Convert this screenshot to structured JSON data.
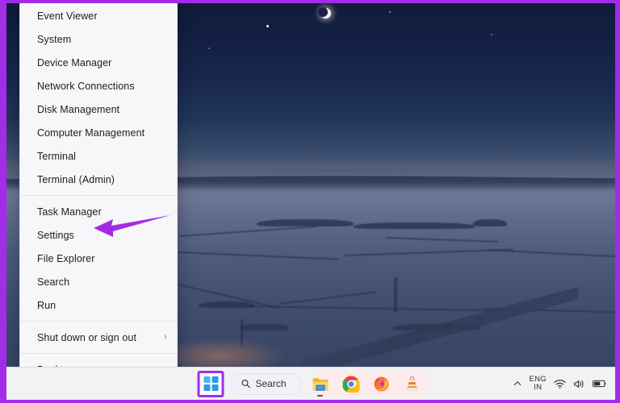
{
  "window": {
    "os": "Windows 11",
    "annotation_color": "#a32ce8"
  },
  "context_menu": {
    "name": "Win+X Quick Link menu",
    "items": [
      {
        "label": "Event Viewer",
        "has_submenu": false,
        "separator_after": false
      },
      {
        "label": "System",
        "has_submenu": false,
        "separator_after": false
      },
      {
        "label": "Device Manager",
        "has_submenu": false,
        "separator_after": false
      },
      {
        "label": "Network Connections",
        "has_submenu": false,
        "separator_after": false
      },
      {
        "label": "Disk Management",
        "has_submenu": false,
        "separator_after": false
      },
      {
        "label": "Computer Management",
        "has_submenu": false,
        "separator_after": false
      },
      {
        "label": "Terminal",
        "has_submenu": false,
        "separator_after": false
      },
      {
        "label": "Terminal (Admin)",
        "has_submenu": false,
        "separator_after": true
      },
      {
        "label": "Task Manager",
        "has_submenu": false,
        "separator_after": false
      },
      {
        "label": "Settings",
        "has_submenu": false,
        "separator_after": false,
        "highlighted_by_arrow": true
      },
      {
        "label": "File Explorer",
        "has_submenu": false,
        "separator_after": false
      },
      {
        "label": "Search",
        "has_submenu": false,
        "separator_after": false
      },
      {
        "label": "Run",
        "has_submenu": false,
        "separator_after": true
      },
      {
        "label": "Shut down or sign out",
        "has_submenu": true,
        "submenu_glyph": "›",
        "separator_after": true
      },
      {
        "label": "Desktop",
        "has_submenu": false,
        "separator_after": false
      }
    ]
  },
  "annotation": {
    "arrow_target": "Settings",
    "arrow_direction": "left",
    "color": "#a22ce6"
  },
  "taskbar": {
    "start_button": {
      "name": "Start",
      "highlighted": true,
      "highlight_color": "#a32ce8"
    },
    "search": {
      "label": "Search",
      "placeholder": "Search",
      "icon": "search-icon"
    },
    "pinned_apps": [
      {
        "name": "File Explorer",
        "icon": "file-explorer-icon",
        "running": true
      },
      {
        "name": "Google Chrome",
        "icon": "chrome-icon",
        "running": false
      },
      {
        "name": "Mozilla Firefox",
        "icon": "firefox-icon",
        "running": false
      },
      {
        "name": "VLC media player",
        "icon": "vlc-cone-icon",
        "running": false
      }
    ],
    "redacted_region": true,
    "tray": {
      "overflow_icon": "chevron-up-icon",
      "language_line1": "ENG",
      "language_line2": "IN",
      "icons": [
        {
          "name": "wifi-icon"
        },
        {
          "name": "volume-icon"
        },
        {
          "name": "battery-icon"
        }
      ]
    }
  },
  "desktop": {
    "wallpaper_description": "Snow-covered rolling farmland at twilight with a crescent moon and orange sunset band on the horizon",
    "moon": "crescent-moon"
  }
}
